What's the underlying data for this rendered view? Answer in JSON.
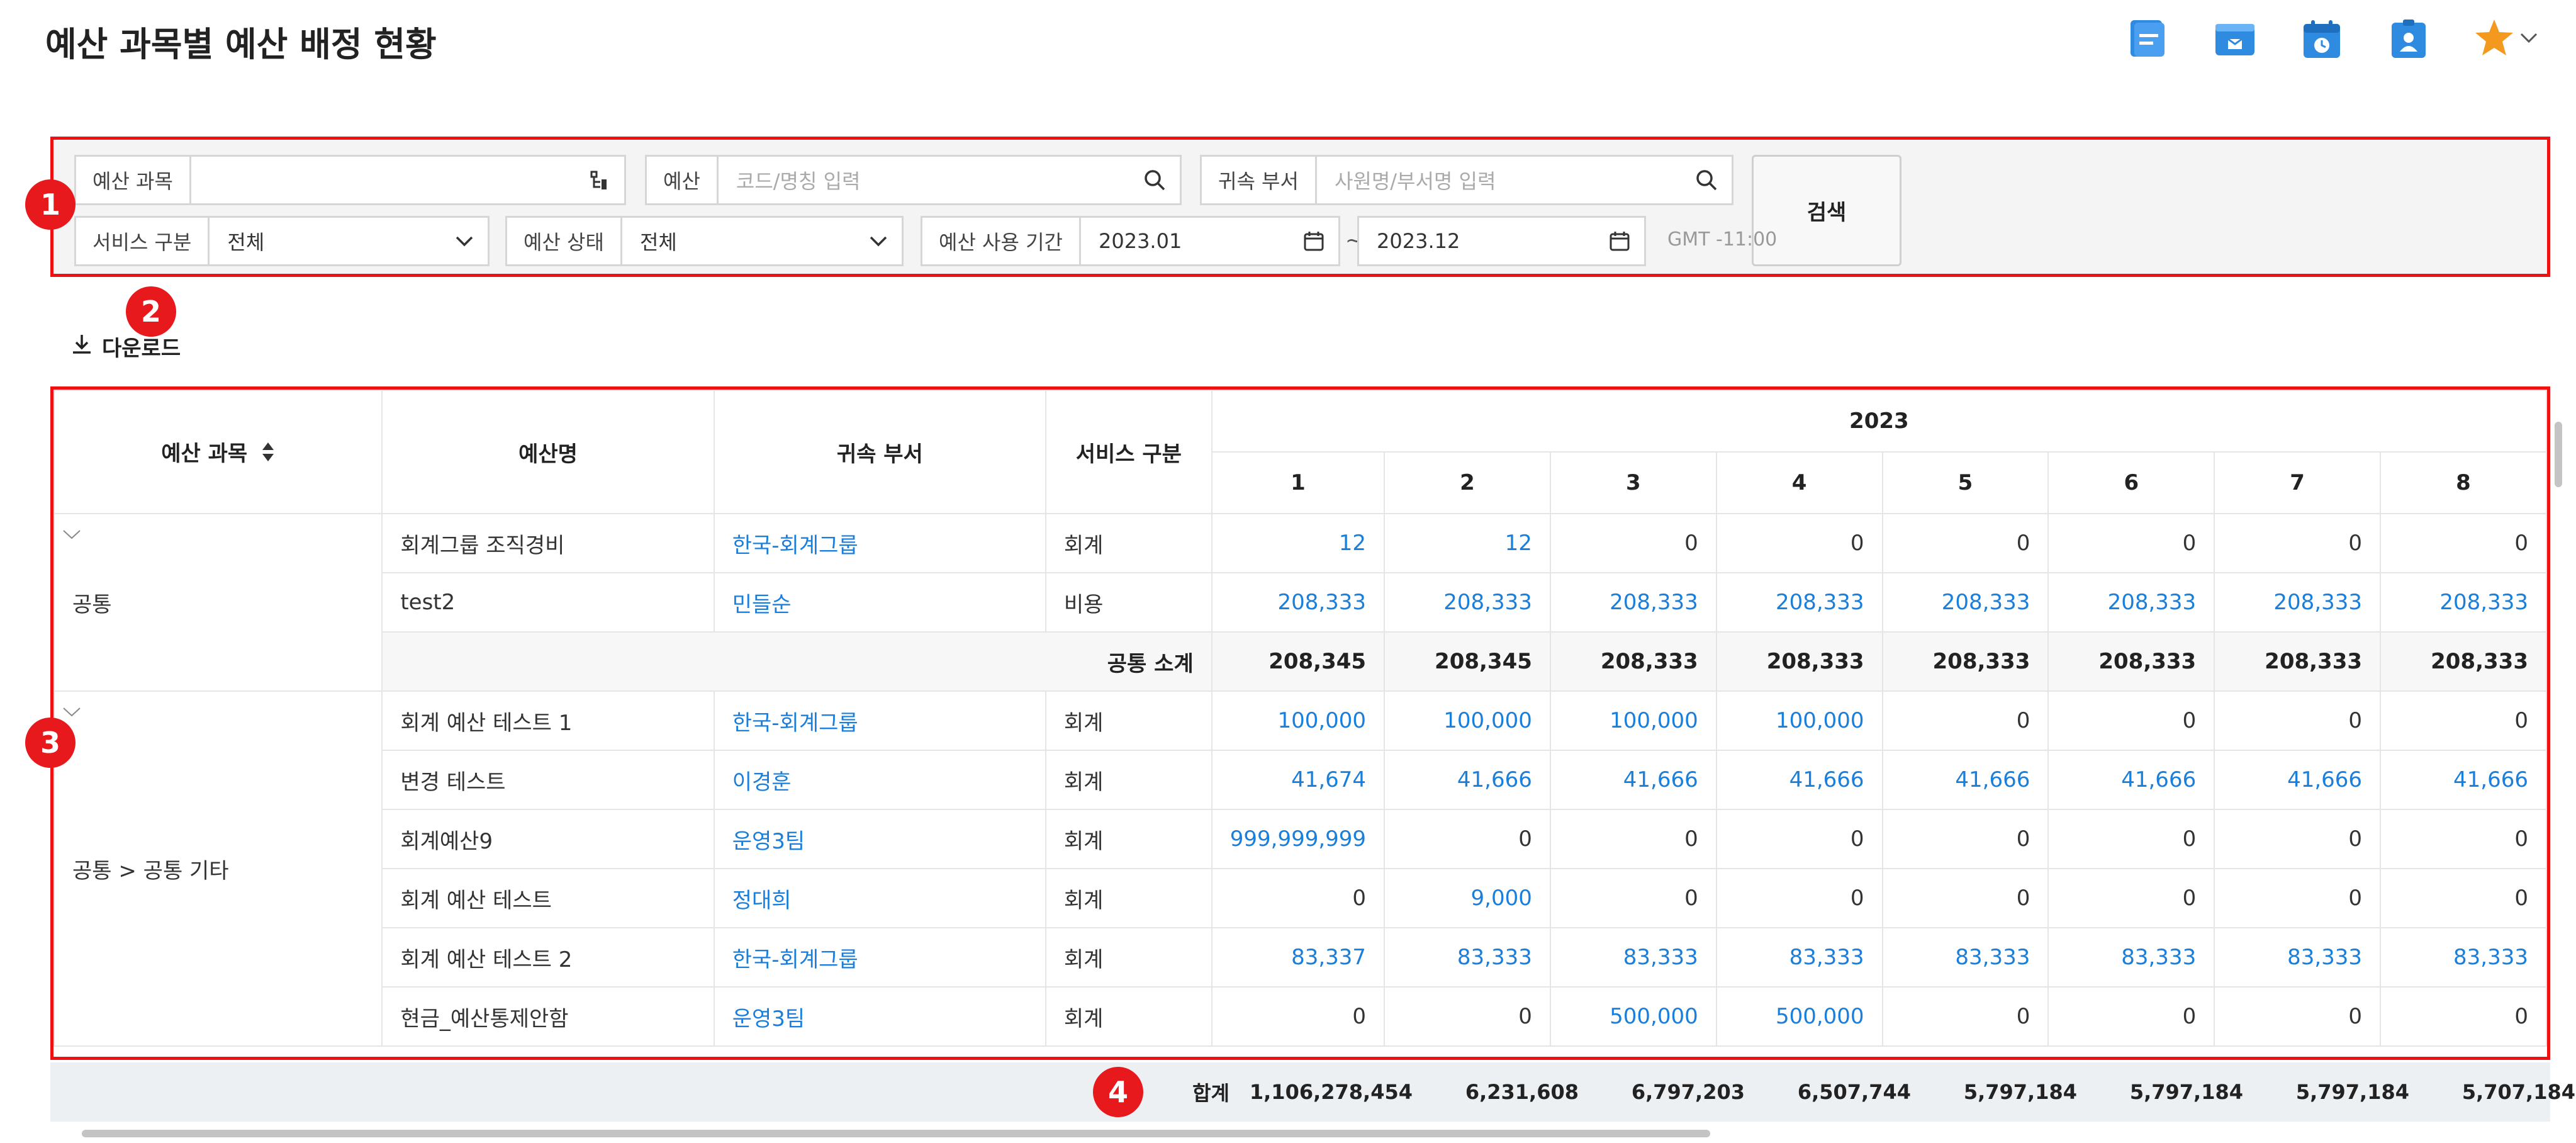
{
  "title": "예산 과목별 예산 배정 현황",
  "header_icons": [
    "document-icon",
    "mail-icon",
    "calendar-icon",
    "contact-icon",
    "star-icon",
    "chevron-down-icon"
  ],
  "filters": {
    "budget_subject": {
      "label": "예산 과목",
      "value": ""
    },
    "budget": {
      "label": "예산",
      "placeholder": "코드/명칭 입력"
    },
    "department": {
      "label": "귀속 부서",
      "placeholder": "사원명/부서명 입력"
    },
    "service_type": {
      "label": "서비스 구분",
      "value": "전체"
    },
    "budget_status": {
      "label": "예산 상태",
      "value": "전체"
    },
    "period": {
      "label": "예산 사용 기간",
      "from": "2023.01",
      "to": "2023.12",
      "separator": "~"
    },
    "timezone": "GMT -11:00",
    "search_label": "검색"
  },
  "markers": [
    "1",
    "2",
    "3",
    "4"
  ],
  "download_label": "다운로드",
  "table": {
    "headers": {
      "subject": "예산 과목",
      "name": "예산명",
      "department": "귀속 부서",
      "service": "서비스 구분",
      "year": "2023"
    },
    "months": [
      "1",
      "2",
      "3",
      "4",
      "5",
      "6",
      "7",
      "8"
    ],
    "groups": [
      {
        "category": "공통",
        "rows": [
          {
            "name": "회계그룹 조직경비",
            "department": "한국-회계그룹",
            "service": "회계",
            "values": [
              "12",
              "12",
              "0",
              "0",
              "0",
              "0",
              "0",
              "0"
            ]
          },
          {
            "name": "test2",
            "department": "민들순",
            "service": "비용",
            "values": [
              "208,333",
              "208,333",
              "208,333",
              "208,333",
              "208,333",
              "208,333",
              "208,333",
              "208,333"
            ]
          }
        ],
        "subtotal_label": "공통 소계",
        "subtotal": [
          "208,345",
          "208,345",
          "208,333",
          "208,333",
          "208,333",
          "208,333",
          "208,333",
          "208,333"
        ]
      },
      {
        "category": "공통 > 공통 기타",
        "rows": [
          {
            "name": "회계 예산 테스트 1",
            "department": "한국-회계그룹",
            "service": "회계",
            "values": [
              "100,000",
              "100,000",
              "100,000",
              "100,000",
              "0",
              "0",
              "0",
              "0"
            ]
          },
          {
            "name": "변경 테스트",
            "department": "이경훈",
            "service": "회계",
            "values": [
              "41,674",
              "41,666",
              "41,666",
              "41,666",
              "41,666",
              "41,666",
              "41,666",
              "41,666"
            ]
          },
          {
            "name": "회계예산9",
            "department": "운영3팀",
            "service": "회계",
            "values": [
              "999,999,999",
              "0",
              "0",
              "0",
              "0",
              "0",
              "0",
              "0"
            ]
          },
          {
            "name": "회계 예산 테스트",
            "department": "정대희",
            "service": "회계",
            "values": [
              "0",
              "9,000",
              "0",
              "0",
              "0",
              "0",
              "0",
              "0"
            ]
          },
          {
            "name": "회계 예산 테스트 2",
            "department": "한국-회계그룹",
            "service": "회계",
            "values": [
              "83,337",
              "83,333",
              "83,333",
              "83,333",
              "83,333",
              "83,333",
              "83,333",
              "83,333"
            ]
          },
          {
            "name": "현금_예산통제안함",
            "department": "운영3팀",
            "service": "회계",
            "values": [
              "0",
              "0",
              "500,000",
              "500,000",
              "0",
              "0",
              "0",
              "0"
            ]
          }
        ]
      }
    ],
    "total_label": "합계",
    "totals": [
      "1,106,278,454",
      "6,231,608",
      "6,797,203",
      "6,507,744",
      "5,797,184",
      "5,797,184",
      "5,797,184",
      "5,707,184"
    ]
  },
  "colors": {
    "accent": "#1a7fdb",
    "marker": "#e8191c",
    "highlight_border": "#ee1111",
    "icon_blue": "#2f8be0",
    "star": "#f39a1e"
  }
}
